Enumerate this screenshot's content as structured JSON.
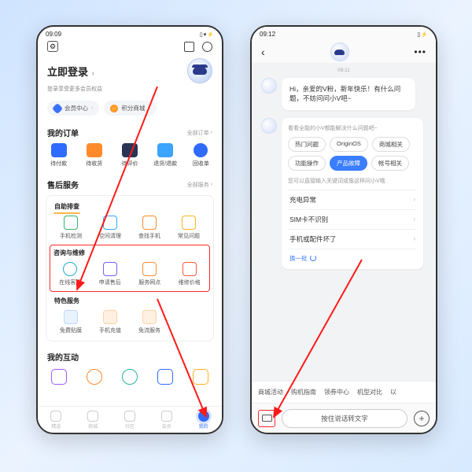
{
  "left": {
    "status_time": "09:09",
    "login_title": "立即登录",
    "login_sub": "登录享受更多会员权益",
    "pills": {
      "member": "会员中心",
      "points": "积分商城"
    },
    "orders": {
      "title": "我的订单",
      "more": "全部订单",
      "items": [
        "待付款",
        "待收货",
        "待评价",
        "退货/退款",
        "回收单"
      ]
    },
    "after": {
      "title": "售后服务",
      "more": "全部服务",
      "self": "自助排查",
      "self_items": [
        "手机检测",
        "空间清理",
        "查找手机",
        "常见问题"
      ],
      "repair": "咨询与维修",
      "repair_items": [
        "在线客服",
        "申请售后",
        "服务网点",
        "维修价格"
      ],
      "special": "特色服务",
      "special_items": [
        "免费贴膜",
        "手机充值",
        "免流服务"
      ]
    },
    "interact_title": "我的互动",
    "tabs": [
      "精选",
      "商城",
      "社区",
      "会员",
      "我的"
    ]
  },
  "right": {
    "status_time": "09:12",
    "msg_time": "09:11",
    "greeting": "Hi，亲爱的V粉，新年快乐！有什么问题，不妨问问小V吧~",
    "card_hint": "看看全能的小V都能解决什么问题吧~",
    "chips": [
      "热门问题",
      "OriginOS",
      "商城相关",
      "功能操作",
      "产品故障",
      "帐号相关"
    ],
    "chip_active_index": 4,
    "card_sub": "您可以直接输入关键词或像这样问小V哦",
    "quick": [
      "充电异常",
      "SIM卡不识别",
      "手机或配件坏了"
    ],
    "refresh": "换一批",
    "suggest": [
      "商城活动",
      "购机指南",
      "领券中心",
      "机型对比",
      "以"
    ],
    "voice_placeholder": "按住说话转文字"
  }
}
